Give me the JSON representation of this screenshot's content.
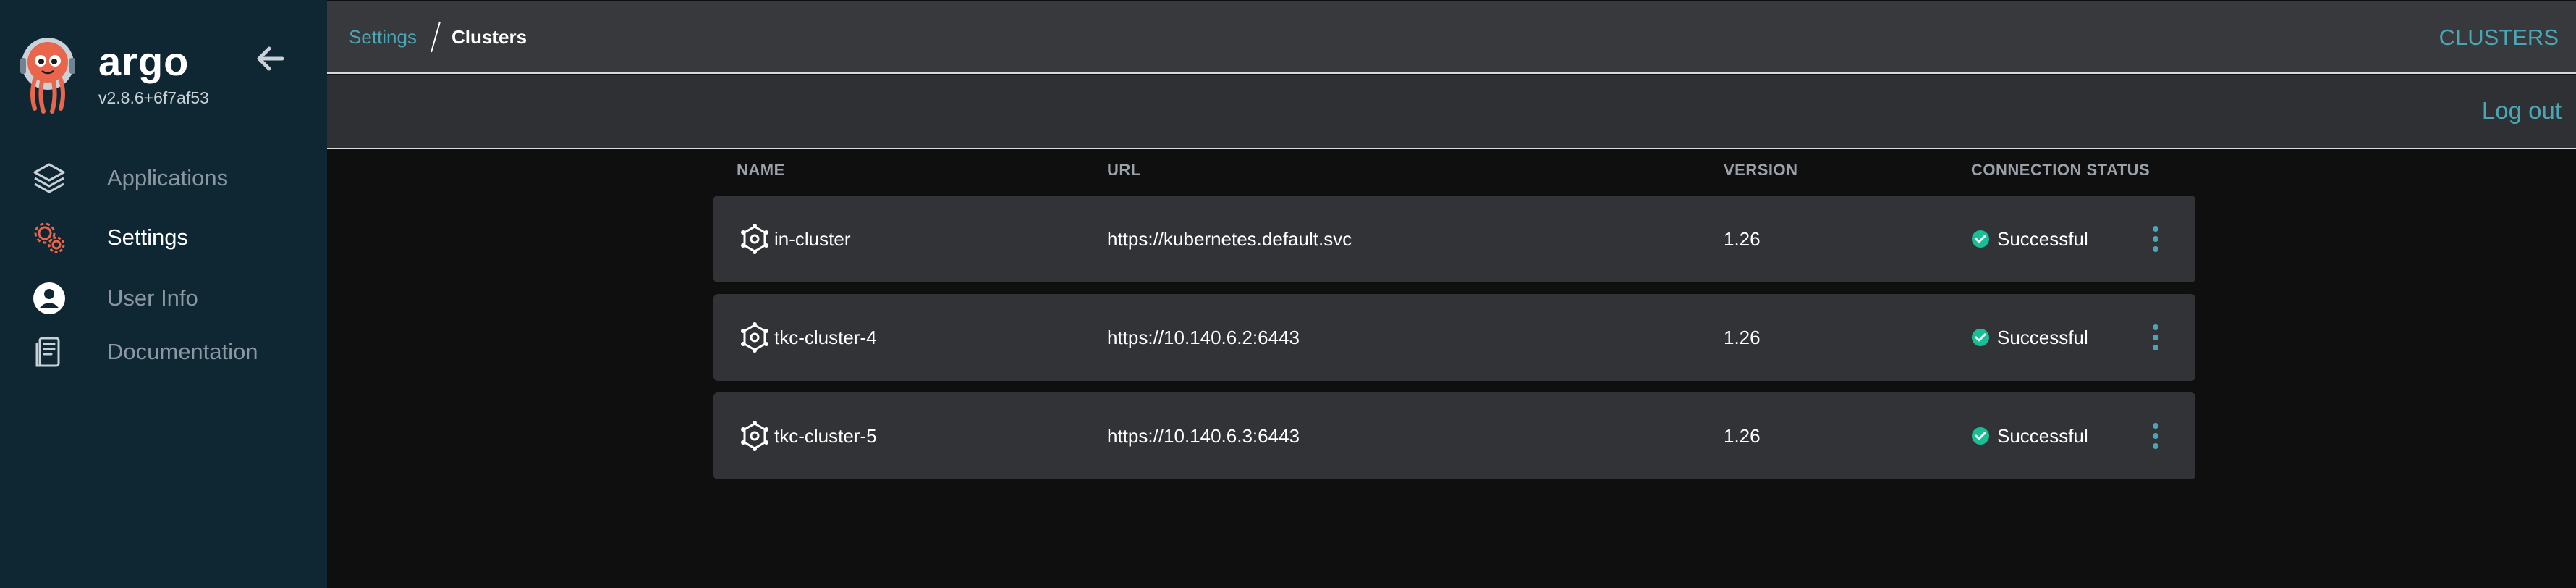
{
  "app": {
    "brand": "argo",
    "version": "v2.8.6+6f7af53"
  },
  "sidebar": {
    "items": [
      {
        "label": "Applications",
        "icon": "layers-icon",
        "active": false
      },
      {
        "label": "Settings",
        "icon": "gears-icon",
        "active": true
      },
      {
        "label": "User Info",
        "icon": "user-circle-icon",
        "active": false
      },
      {
        "label": "Documentation",
        "icon": "book-icon",
        "active": false
      }
    ]
  },
  "breadcrumb": {
    "parent": "Settings",
    "current": "Clusters"
  },
  "header": {
    "title": "CLUSTERS",
    "logout_label": "Log out"
  },
  "table": {
    "columns": [
      "NAME",
      "URL",
      "VERSION",
      "CONNECTION STATUS"
    ],
    "rows": [
      {
        "name": "in-cluster",
        "url": "https://kubernetes.default.svc",
        "version": "1.26",
        "status": "Successful"
      },
      {
        "name": "tkc-cluster-4",
        "url": "https://10.140.6.2:6443",
        "version": "1.26",
        "status": "Successful"
      },
      {
        "name": "tkc-cluster-5",
        "url": "https://10.140.6.3:6443",
        "version": "1.26",
        "status": "Successful"
      }
    ]
  },
  "colors": {
    "sidebar_bg": "#0f2633",
    "accent": "#4aa6b5",
    "success": "#18be94",
    "logo_orange": "#e9654b"
  }
}
